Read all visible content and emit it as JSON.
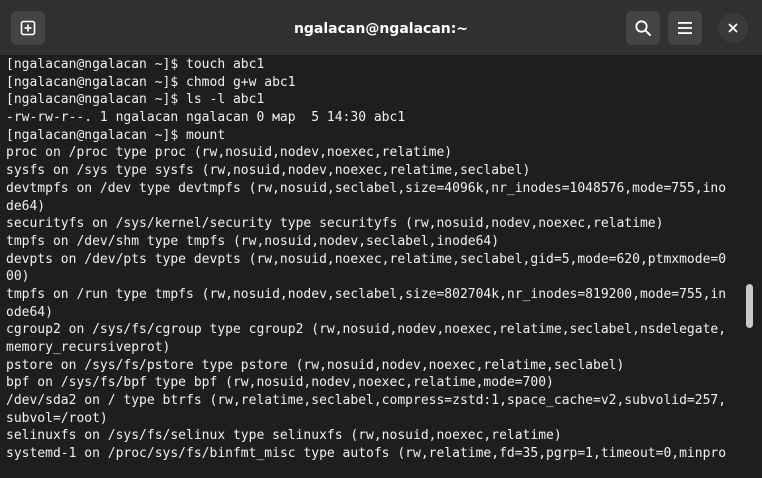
{
  "window": {
    "title": "ngalacan@ngalacan:~"
  },
  "icons": {
    "new_tab": "new-tab-icon",
    "search": "search-icon",
    "menu": "hamburger-menu-icon",
    "close": "close-icon"
  },
  "colors": {
    "titlebar": "#303030",
    "terminal_bg": "#1e1e1e",
    "terminal_fg": "#f0f0f0"
  },
  "terminal": {
    "lines": [
      "[ngalacan@ngalacan ~]$ touch abc1",
      "[ngalacan@ngalacan ~]$ chmod g+w abc1",
      "[ngalacan@ngalacan ~]$ ls -l abc1",
      "-rw-rw-r--. 1 ngalacan ngalacan 0 мар  5 14:30 abc1",
      "[ngalacan@ngalacan ~]$ mount",
      "proc on /proc type proc (rw,nosuid,nodev,noexec,relatime)",
      "sysfs on /sys type sysfs (rw,nosuid,nodev,noexec,relatime,seclabel)",
      "devtmpfs on /dev type devtmpfs (rw,nosuid,seclabel,size=4096k,nr_inodes=1048576,mode=755,ino",
      "de64)",
      "securityfs on /sys/kernel/security type securityfs (rw,nosuid,nodev,noexec,relatime)",
      "tmpfs on /dev/shm type tmpfs (rw,nosuid,nodev,seclabel,inode64)",
      "devpts on /dev/pts type devpts (rw,nosuid,noexec,relatime,seclabel,gid=5,mode=620,ptmxmode=0",
      "00)",
      "tmpfs on /run type tmpfs (rw,nosuid,nodev,seclabel,size=802704k,nr_inodes=819200,mode=755,in",
      "ode64)",
      "cgroup2 on /sys/fs/cgroup type cgroup2 (rw,nosuid,nodev,noexec,relatime,seclabel,nsdelegate,",
      "memory_recursiveprot)",
      "pstore on /sys/fs/pstore type pstore (rw,nosuid,nodev,noexec,relatime,seclabel)",
      "bpf on /sys/fs/bpf type bpf (rw,nosuid,nodev,noexec,relatime,mode=700)",
      "/dev/sda2 on / type btrfs (rw,relatime,seclabel,compress=zstd:1,space_cache=v2,subvolid=257,",
      "subvol=/root)",
      "selinuxfs on /sys/fs/selinux type selinuxfs (rw,nosuid,noexec,relatime)",
      "systemd-1 on /proc/sys/fs/binfmt_misc type autofs (rw,relatime,fd=35,pgrp=1,timeout=0,minpro"
    ]
  }
}
